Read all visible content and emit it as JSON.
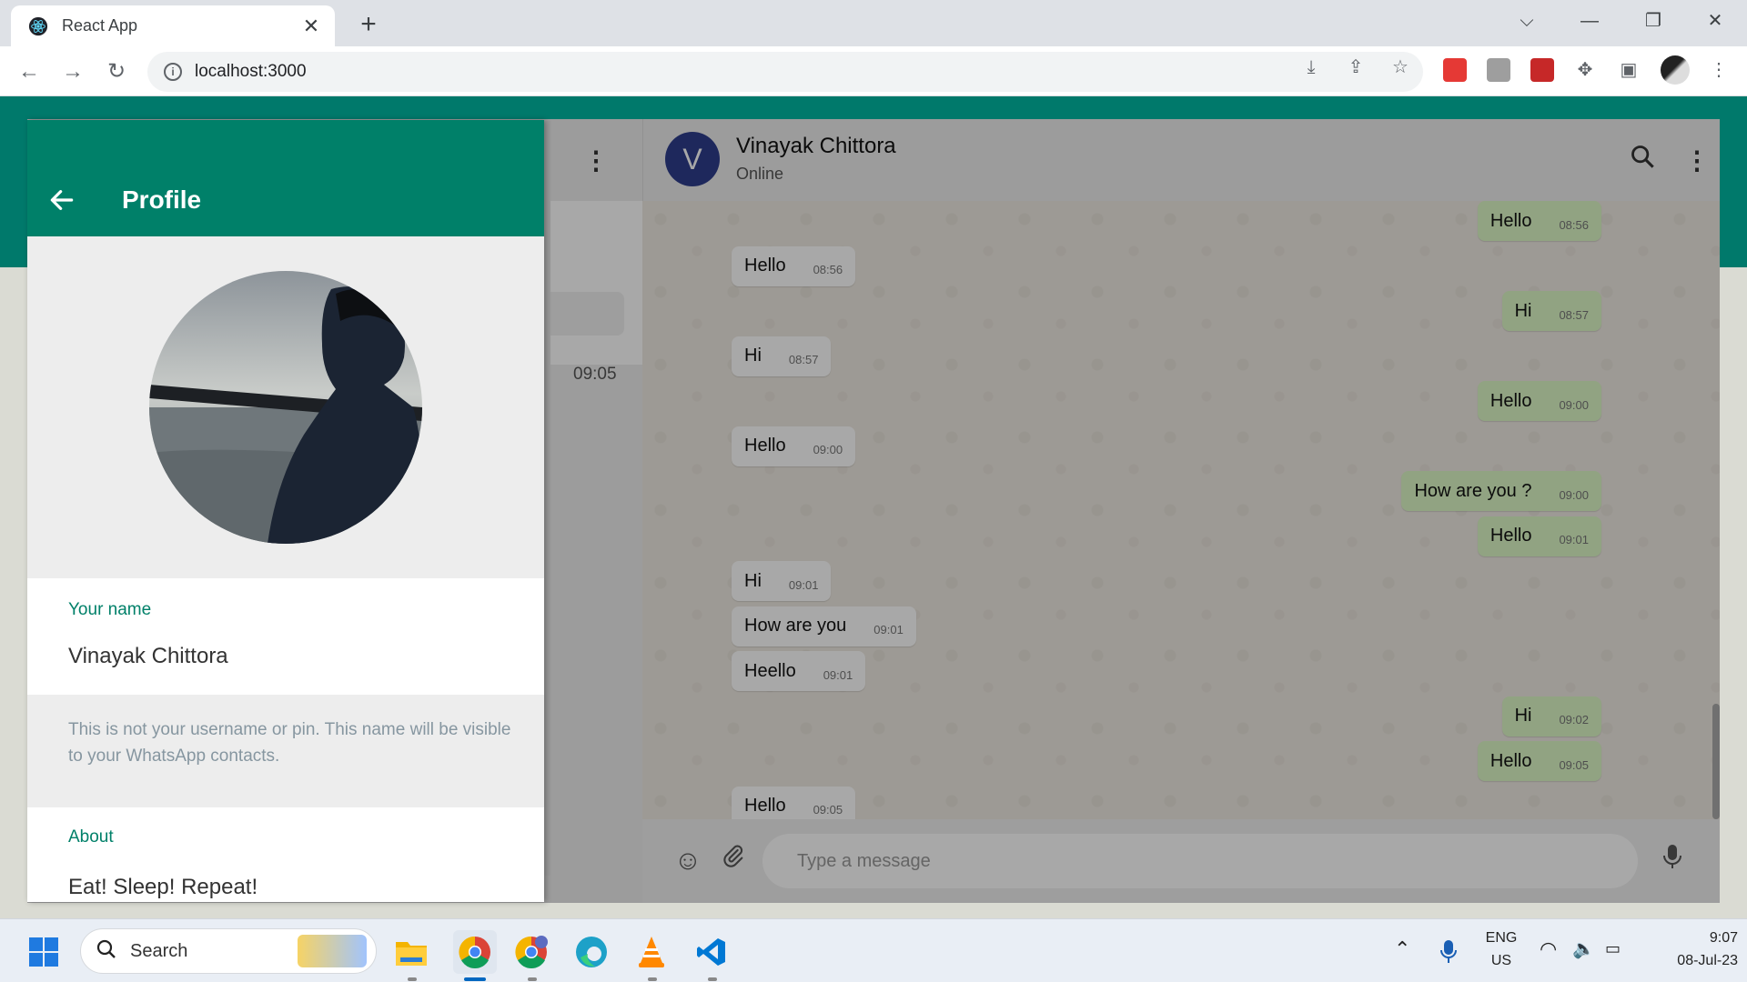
{
  "browser": {
    "tab_title": "React App",
    "url": "localhost:3000"
  },
  "sidebar": {
    "chat_time": "09:05"
  },
  "chat": {
    "contact_initial": "V",
    "contact_name": "Vinayak Chittora",
    "contact_status": "Online",
    "composer_placeholder": "Type a message",
    "messages": [
      {
        "direction": "out",
        "text": "Hello",
        "time": "08:56"
      },
      {
        "direction": "in",
        "text": "Hello",
        "time": "08:56"
      },
      {
        "direction": "out",
        "text": "Hi",
        "time": "08:57"
      },
      {
        "direction": "in",
        "text": "Hi",
        "time": "08:57"
      },
      {
        "direction": "out",
        "text": "Hello",
        "time": "09:00"
      },
      {
        "direction": "in",
        "text": "Hello",
        "time": "09:00"
      },
      {
        "direction": "out",
        "text": "How are you ?",
        "time": "09:00"
      },
      {
        "direction": "out",
        "text": "Hello",
        "time": "09:01"
      },
      {
        "direction": "in",
        "text": "Hi",
        "time": "09:01"
      },
      {
        "direction": "in",
        "text": "How are you",
        "time": "09:01"
      },
      {
        "direction": "in",
        "text": "Heello",
        "time": "09:01"
      },
      {
        "direction": "out",
        "text": "Hi",
        "time": "09:02"
      },
      {
        "direction": "out",
        "text": "Hello",
        "time": "09:05"
      },
      {
        "direction": "in",
        "text": "Hello",
        "time": "09:05"
      }
    ]
  },
  "profile": {
    "title": "Profile",
    "name_label": "Your name",
    "name_value": "Vinayak Chittora",
    "hint": "This is not your username or pin. This name will be visible to your WhatsApp contacts.",
    "about_label": "About",
    "about_value": "Eat! Sleep! Repeat!"
  },
  "taskbar": {
    "search_label": "Search",
    "lang_top": "ENG",
    "lang_bottom": "US",
    "time": "9:07",
    "date": "08-Jul-23"
  },
  "colors": {
    "brand_green": "#008069",
    "header_teal": "#00796b",
    "outgoing_bubble": "#dcf8c6"
  }
}
